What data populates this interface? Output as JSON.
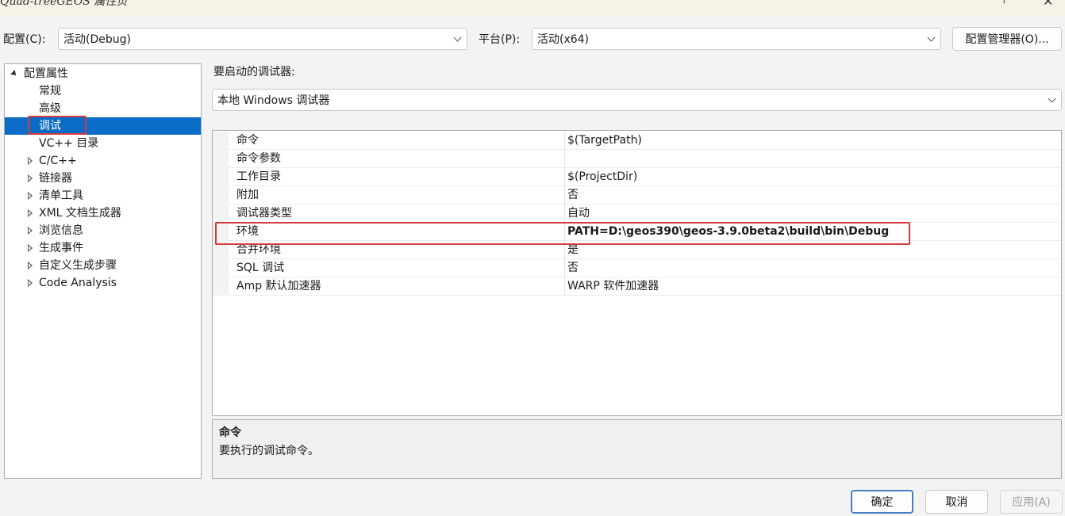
{
  "window": {
    "title": "Quad-treeGEOS 属性页",
    "help_label": "?",
    "close_label": "✕"
  },
  "config": {
    "config_label": "配置(C):",
    "config_value": "活动(Debug)",
    "platform_label": "平台(P):",
    "platform_value": "活动(x64)",
    "manager_button": "配置管理器(O)..."
  },
  "tree": {
    "root": "配置属性",
    "items": [
      {
        "label": "常规"
      },
      {
        "label": "高级"
      },
      {
        "label": "调试"
      },
      {
        "label": "VC++ 目录"
      },
      {
        "label": "C/C++"
      },
      {
        "label": "链接器"
      },
      {
        "label": "清单工具"
      },
      {
        "label": "XML 文档生成器"
      },
      {
        "label": "浏览信息"
      },
      {
        "label": "生成事件"
      },
      {
        "label": "自定义生成步骤"
      },
      {
        "label": "Code Analysis"
      }
    ],
    "selected": "调试"
  },
  "debugger": {
    "label": "要启动的调试器:",
    "value": "本地 Windows 调试器"
  },
  "properties": {
    "rows": [
      {
        "name": "命令",
        "value": "$(TargetPath)"
      },
      {
        "name": "命令参数",
        "value": ""
      },
      {
        "name": "工作目录",
        "value": "$(ProjectDir)"
      },
      {
        "name": "附加",
        "value": "否"
      },
      {
        "name": "调试器类型",
        "value": "自动"
      },
      {
        "name": "环境",
        "value": "PATH=D:\\geos390\\geos-3.9.0beta2\\build\\bin\\Debug"
      },
      {
        "name": "合并环境",
        "value": "是"
      },
      {
        "name": "SQL 调试",
        "value": "否"
      },
      {
        "name": "Amp 默认加速器",
        "value": "WARP 软件加速器"
      }
    ]
  },
  "description": {
    "title": "命令",
    "text": "要执行的调试命令。"
  },
  "buttons": {
    "ok": "确定",
    "cancel": "取消",
    "apply": "应用(A)"
  }
}
